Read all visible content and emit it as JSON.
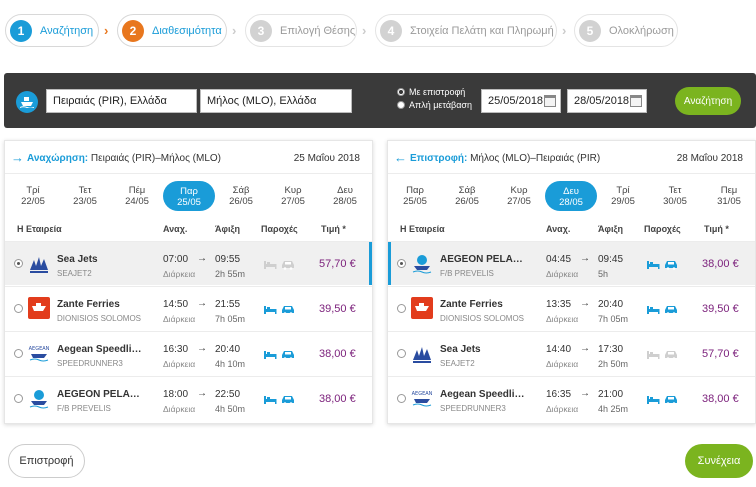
{
  "steps": [
    {
      "num": "1",
      "label": "Αναζήτηση",
      "state": "done"
    },
    {
      "num": "2",
      "label": "Διαθεσιμότητα",
      "state": "current"
    },
    {
      "num": "3",
      "label": "Επιλογή Θέσης",
      "state": "upcoming"
    },
    {
      "num": "4",
      "label": "Στοιχεία Πελάτη και Πληρωμή",
      "state": "upcoming"
    },
    {
      "num": "5",
      "label": "Ολοκλήρωση",
      "state": "upcoming"
    }
  ],
  "search": {
    "from": "Πειραιάς (PIR), Ελλάδα",
    "to": "Μήλος (MLO), Ελλάδα",
    "trip_roundtrip": "Με επιστροφή",
    "trip_oneway": "Απλή μετάβαση",
    "date_out": "25/05/2018",
    "date_return": "28/05/2018",
    "button": "Αναζήτηση"
  },
  "columns": {
    "company": "Η Εταιρεία",
    "departure": "Αναχ.",
    "arrival": "Άφιξη",
    "amenities": "Παροχές",
    "price": "Τιμή *"
  },
  "duration_label": "Διάρκεια",
  "outbound": {
    "label": "Αναχώρηση:",
    "route": "Πειραιάς (PIR)–Μήλος (MLO)",
    "date": "25 Μαΐου 2018",
    "days": [
      {
        "name": "Τρί",
        "date": "22/05"
      },
      {
        "name": "Τετ",
        "date": "23/05"
      },
      {
        "name": "Πέμ",
        "date": "24/05"
      },
      {
        "name": "Παρ",
        "date": "25/05"
      },
      {
        "name": "Σάβ",
        "date": "26/05"
      },
      {
        "name": "Κυρ",
        "date": "27/05"
      },
      {
        "name": "Δευ",
        "date": "28/05"
      }
    ],
    "selected_day": 3,
    "rows": [
      {
        "company": "Sea Jets",
        "vessel": "SEAJET2",
        "dep": "07:00",
        "arr": "09:55",
        "duration": "2h 55m",
        "price": "57,70 €",
        "logo": "sea-jets",
        "selected": true
      },
      {
        "company": "Zante Ferries",
        "vessel": "DIONISIOS SOLOMOS",
        "dep": "14:50",
        "arr": "21:55",
        "duration": "7h 05m",
        "price": "39,50 €",
        "logo": "zante",
        "selected": false
      },
      {
        "company": "Aegean Speedli…",
        "vessel": "SPEEDRUNNER3",
        "dep": "16:30",
        "arr": "20:40",
        "duration": "4h 10m",
        "price": "38,00 €",
        "logo": "aegean-speed",
        "selected": false
      },
      {
        "company": "AEGEON PELA…",
        "vessel": "F/B PREVELIS",
        "dep": "18:00",
        "arr": "22:50",
        "duration": "4h 50m",
        "price": "38,00 €",
        "logo": "aegeon",
        "selected": false
      }
    ]
  },
  "inbound": {
    "label": "Επιστροφή:",
    "route": "Μήλος (MLO)–Πειραιάς (PIR)",
    "date": "28 Μαΐου 2018",
    "days": [
      {
        "name": "Παρ",
        "date": "25/05"
      },
      {
        "name": "Σάβ",
        "date": "26/05"
      },
      {
        "name": "Κυρ",
        "date": "27/05"
      },
      {
        "name": "Δευ",
        "date": "28/05"
      },
      {
        "name": "Τρί",
        "date": "29/05"
      },
      {
        "name": "Τετ",
        "date": "30/05"
      },
      {
        "name": "Πεμ",
        "date": "31/05"
      }
    ],
    "selected_day": 3,
    "rows": [
      {
        "company": "AEGEON PELA…",
        "vessel": "F/B PREVELIS",
        "dep": "04:45",
        "arr": "09:45",
        "duration": "5h",
        "price": "38,00 €",
        "logo": "aegeon",
        "selected": true
      },
      {
        "company": "Zante Ferries",
        "vessel": "DIONISIOS SOLOMOS",
        "dep": "13:35",
        "arr": "20:40",
        "duration": "7h 05m",
        "price": "39,50 €",
        "logo": "zante",
        "selected": false
      },
      {
        "company": "Sea Jets",
        "vessel": "SEAJET2",
        "dep": "14:40",
        "arr": "17:30",
        "duration": "2h 50m",
        "price": "57,70 €",
        "logo": "sea-jets",
        "selected": false
      },
      {
        "company": "Aegean Speedli…",
        "vessel": "SPEEDRUNNER3",
        "dep": "16:35",
        "arr": "21:00",
        "duration": "4h 25m",
        "price": "38,00 €",
        "logo": "aegean-speed",
        "selected": false
      }
    ]
  },
  "footer": {
    "back": "Επιστροφή",
    "next": "Συνέχεια"
  },
  "colors": {
    "accent": "#1a9cd8",
    "current_step": "#e8771e",
    "green": "#7bb41f",
    "price": "#7a1e7a"
  }
}
